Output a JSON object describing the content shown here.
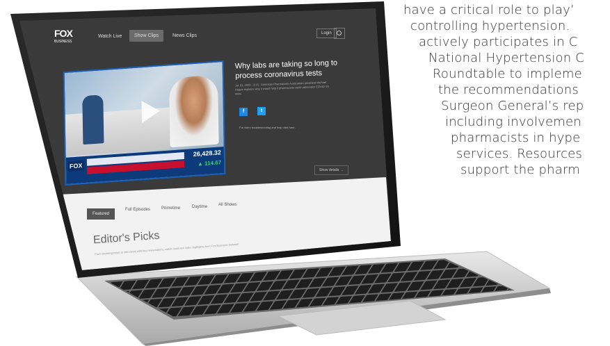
{
  "article": {
    "lines": [
      "have a critical role to play’",
      "controlling hypertension.",
      "actively participates in C",
      "National Hypertension C",
      "Roundtable to impleme",
      "the recommendations",
      "Surgeon General’s rep",
      "including involvemen",
      "pharmacists in hype",
      "services. Resources",
      "support the pharm"
    ]
  },
  "site": {
    "logo_main": "FOX",
    "logo_sub": "BUSINESS",
    "nav": [
      "Watch Live",
      "Show Clips",
      "News Clips"
    ],
    "login": "Login"
  },
  "feature": {
    "headline": "Why labs are taking so long to process coronavirus tests",
    "meta": "Jul. 31, 2020 - 3:15 - American Pharmacists Association president Michael Hogue explains why it would help if pharmacists could administer COVID-19 tests.",
    "note": "For video troubleshooting and help click here.",
    "more_button": "Show details →",
    "ticker_value": "26,428.32",
    "ticker_change": "▲ 114.67"
  },
  "tabs": [
    "Featured",
    "Full Episodes",
    "Primetime",
    "Daytime",
    "All Shows"
  ],
  "editors": {
    "title": "Editor's Picks",
    "subtitle": "From breaking news to interviews with key newsmakers, watch must-see video highlights from Fox Business Network"
  }
}
